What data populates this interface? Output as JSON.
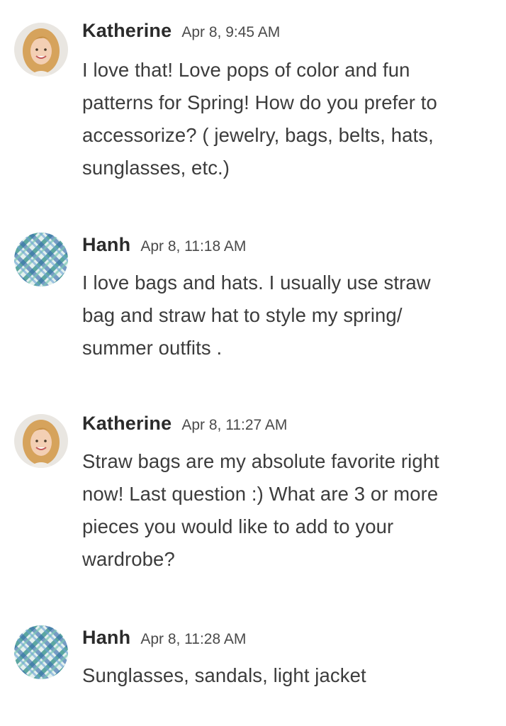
{
  "messages": [
    {
      "author": "Katherine",
      "timestamp": "Apr 8, 9:45 AM",
      "avatar": "katherine-avatar",
      "lines": [
        "I love that! Love pops of color and fun",
        "patterns for Spring! How do you prefer to",
        "accessorize? ( jewelry, bags, belts, hats,",
        "sunglasses, etc.)"
      ]
    },
    {
      "author": "Hanh",
      "timestamp": "Apr 8, 11:18 AM",
      "avatar": "hanh-avatar",
      "lines": [
        "I love bags and hats. I usually use straw",
        "bag and straw hat to style my spring/",
        "summer outfits ."
      ]
    },
    {
      "author": "Katherine",
      "timestamp": "Apr 8, 11:27 AM",
      "avatar": "katherine-avatar",
      "lines": [
        "Straw bags are my absolute favorite right",
        "now! Last question :) What are 3 or more",
        "pieces you would like to add to your",
        "wardrobe?"
      ]
    },
    {
      "author": "Hanh",
      "timestamp": "Apr 8, 11:28 AM",
      "avatar": "hanh-avatar",
      "lines": [
        "Sunglasses, sandals, light jacket"
      ]
    }
  ]
}
